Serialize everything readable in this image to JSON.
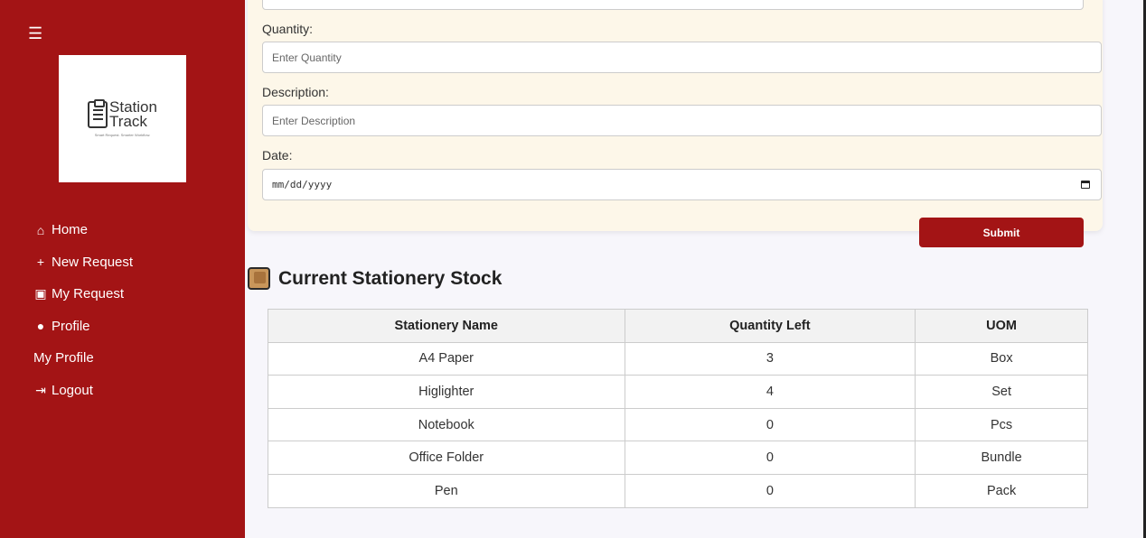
{
  "sidebar": {
    "menu_icon": "hamburger-icon",
    "logo": {
      "line1": "Station",
      "line2": "Track",
      "tagline": "Smart Request. Smarter Workflow."
    },
    "items": [
      {
        "icon": "home-icon",
        "glyph": "⌂",
        "label": "Home"
      },
      {
        "icon": "plus-icon",
        "glyph": "+",
        "label": "New Request"
      },
      {
        "icon": "calendar-check-icon",
        "glyph": "▣",
        "label": "My Request"
      },
      {
        "icon": "user-icon",
        "glyph": "●",
        "label": "Profile"
      },
      {
        "icon": "",
        "glyph": "",
        "label": "My Profile"
      },
      {
        "icon": "logout-icon",
        "glyph": "⇥",
        "label": "Logout"
      }
    ]
  },
  "form": {
    "quantity_label": "Quantity:",
    "quantity_placeholder": "Enter Quantity",
    "description_label": "Description:",
    "description_placeholder": "Enter Description",
    "date_label": "Date:",
    "date_placeholder": "mm/dd/yyyy",
    "submit_label": "Submit"
  },
  "stock": {
    "title": "Current Stationery Stock",
    "columns": [
      "Stationery Name",
      "Quantity Left",
      "UOM"
    ],
    "rows": [
      [
        "A4 Paper",
        "3",
        "Box"
      ],
      [
        "Higlighter",
        "4",
        "Set"
      ],
      [
        "Notebook",
        "0",
        "Pcs"
      ],
      [
        "Office Folder",
        "0",
        "Bundle"
      ],
      [
        "Pen",
        "0",
        "Pack"
      ]
    ]
  },
  "colors": {
    "brand": "#a31415",
    "card": "#fdf7e9",
    "background": "#f7f6fb"
  }
}
